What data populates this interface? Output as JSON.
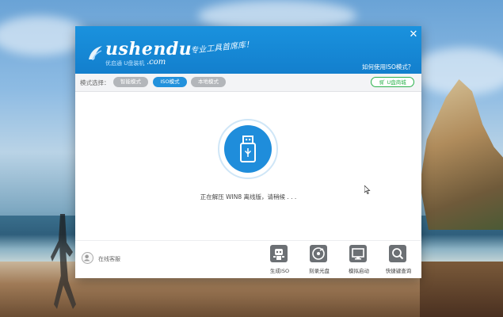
{
  "window": {
    "brand": "ushendu",
    "brand_com": ".com",
    "brand_sub": "优启通  U盘装机",
    "slogan": "专业工具首席库！",
    "help_link": "如何使用ISO模式？",
    "close_glyph": "✕"
  },
  "mode_bar": {
    "label": "模式选择：",
    "modes": [
      {
        "label": "智能模式",
        "active": false
      },
      {
        "label": "ISO模式",
        "active": true
      },
      {
        "label": "本地模式",
        "active": false
      }
    ],
    "udisk_button": "U盘商城"
  },
  "main": {
    "status": "正在解压 WIN8 离线版，请稍候 . . ."
  },
  "footer": {
    "support_label": "在线客服",
    "tools": [
      {
        "label": "生成ISO",
        "icon": "robot-icon"
      },
      {
        "label": "刻录光盘",
        "icon": "disc-icon"
      },
      {
        "label": "模拟启动",
        "icon": "monitor-icon"
      },
      {
        "label": "快捷键查询",
        "icon": "magnifier-icon"
      }
    ]
  },
  "colors": {
    "header_blue": "#1a92de",
    "active_mode": "#2291dc",
    "udisk_green": "#2bb24c",
    "usb_circle": "#1f8ddb"
  }
}
